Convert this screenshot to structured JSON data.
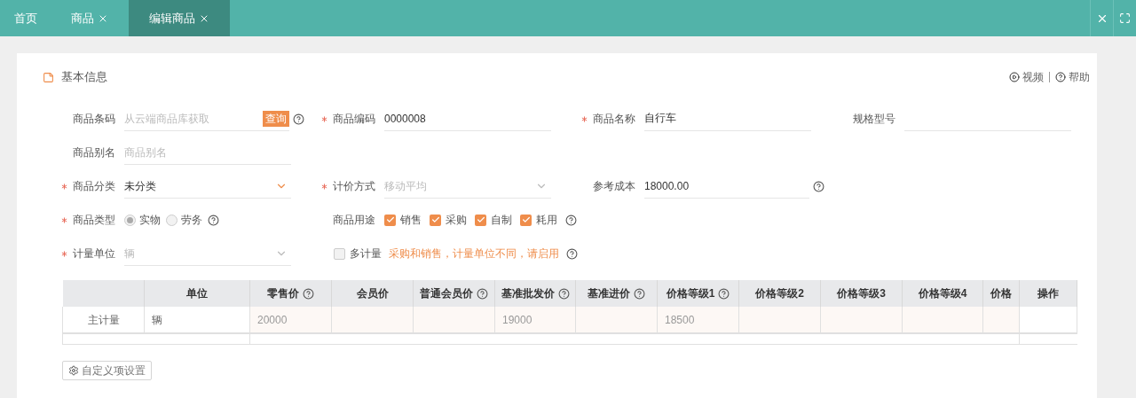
{
  "tabs": [
    {
      "label": "首页",
      "closable": false,
      "selected": false
    },
    {
      "label": "商品",
      "closable": true,
      "selected": false
    },
    {
      "label": "编辑商品",
      "closable": true,
      "selected": true
    }
  ],
  "section": {
    "title": "基本信息",
    "links": [
      {
        "kind": "video",
        "label": "视频"
      },
      {
        "kind": "help",
        "label": "帮助"
      }
    ]
  },
  "form_rows": [
    [
      {
        "kind": "barcode",
        "label": "商品条码",
        "required": false,
        "placeholder": "从云端商品库获取",
        "button": "查询",
        "help": true
      },
      {
        "kind": "text",
        "label": "商品编码",
        "required": true,
        "value": "0000008",
        "help": false
      },
      {
        "kind": "text",
        "label": "商品名称",
        "required": true,
        "value": "自行车",
        "help": false
      },
      {
        "kind": "text",
        "label": "规格型号",
        "required": false,
        "help": false
      }
    ],
    [
      {
        "kind": "text",
        "label": "商品别名",
        "required": false,
        "placeholder": "商品别名",
        "help": false
      }
    ],
    [
      {
        "kind": "select",
        "label": "商品分类",
        "required": true,
        "value": "未分类",
        "disabled": false,
        "help": false
      },
      {
        "kind": "select",
        "label": "计价方式",
        "required": true,
        "value": "移动平均",
        "disabled": true,
        "help": false
      },
      {
        "kind": "text",
        "label": "参考成本",
        "required": false,
        "value": "18000.00",
        "help": true
      }
    ],
    [
      {
        "kind": "radio",
        "label": "商品类型",
        "required": true,
        "options": [
          {
            "label": "实物",
            "selected": true
          },
          {
            "label": "劳务",
            "selected": false
          }
        ],
        "help": true
      },
      {
        "kind": "checkboxes",
        "label": "商品用途",
        "required": false,
        "options": [
          {
            "label": "销售",
            "checked": true
          },
          {
            "label": "采购",
            "checked": true
          },
          {
            "label": "自制",
            "checked": true
          },
          {
            "label": "耗用",
            "checked": true
          }
        ],
        "help": true
      }
    ],
    [
      {
        "kind": "select",
        "label": "计量单位",
        "required": true,
        "value": "辆",
        "disabled": true,
        "help": false
      },
      {
        "kind": "toggle",
        "label": "多计量",
        "checked": false,
        "hint": "采购和销售，计量单位不同，请启用",
        "help": true
      }
    ]
  ],
  "table": {
    "columns": [
      {
        "label": "单位",
        "kind": "unit",
        "help": false
      },
      {
        "label": "零售价",
        "kind": "price",
        "help": true
      },
      {
        "label": "会员价",
        "kind": "price",
        "help": false
      },
      {
        "label": "普通会员价",
        "kind": "price",
        "help": true
      },
      {
        "label": "基准批发价",
        "kind": "price",
        "help": true
      },
      {
        "label": "基准进价",
        "kind": "price",
        "help": true
      },
      {
        "label": "价格等级1",
        "kind": "price",
        "help": true
      },
      {
        "label": "价格等级2",
        "kind": "price",
        "help": false
      },
      {
        "label": "价格等级3",
        "kind": "price",
        "help": false
      },
      {
        "label": "价格等级4",
        "kind": "price",
        "help": false
      },
      {
        "label": "价格",
        "kind": "price",
        "help": false
      },
      {
        "label": "操作",
        "kind": "action",
        "help": false
      }
    ],
    "rows": [
      {
        "label": "主计量",
        "cells": [
          {
            "value": "辆"
          },
          {
            "value": "20000"
          },
          {},
          {},
          {
            "value": "19000"
          },
          {},
          {
            "value": "18500"
          },
          {},
          {},
          {},
          {},
          {}
        ]
      }
    ]
  },
  "custom_button": "自定义项设置"
}
